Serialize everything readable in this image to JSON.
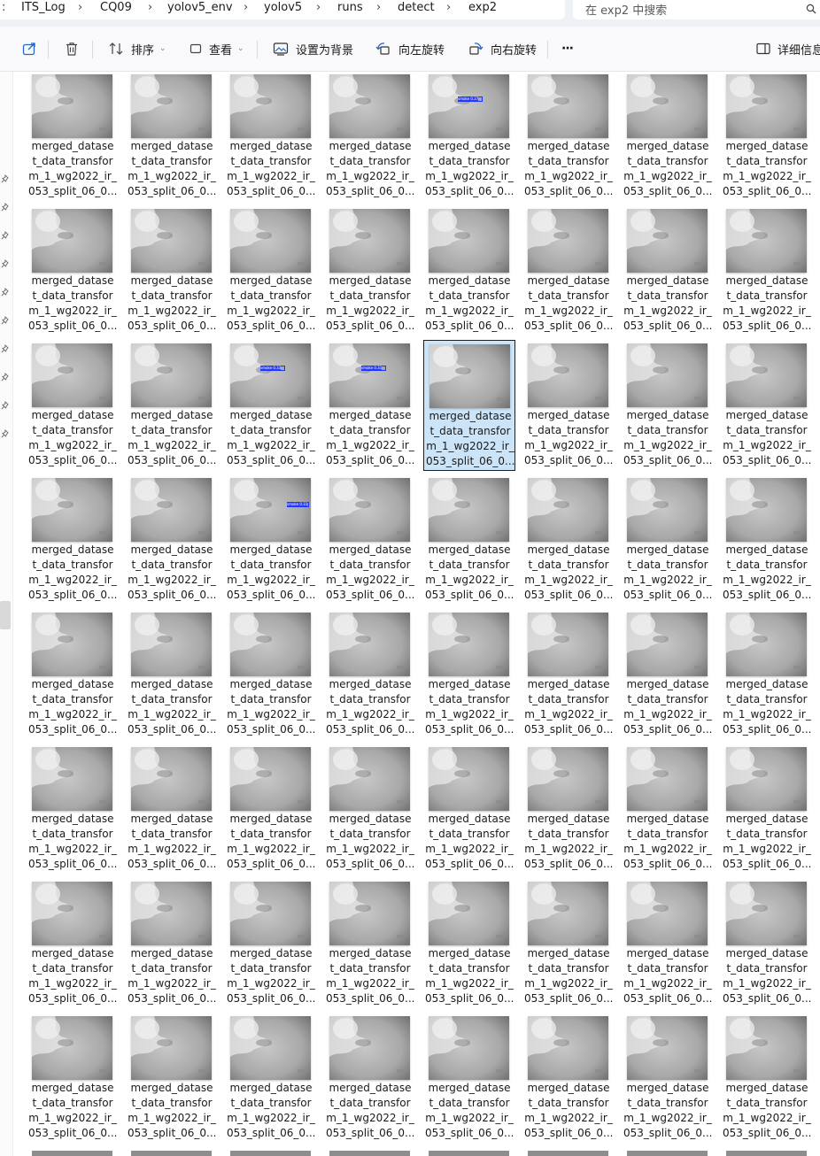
{
  "breadcrumb": [
    "ITS_Log",
    "CQ09",
    "yolov5_env",
    "yolov5",
    "runs",
    "detect",
    "exp2"
  ],
  "search": {
    "placeholder": "在 exp2 中搜索"
  },
  "toolbar": {
    "share_label": "",
    "delete_label": "",
    "sort_label": "排序",
    "view_label": "查看",
    "set_bg_label": "设置为背景",
    "rotate_left_label": "向左旋转",
    "rotate_right_label": "向右旋转",
    "more_label": "···",
    "details_label": "详细信息"
  },
  "files": {
    "caption_lines": [
      "merged_datase",
      "t_data_transfor",
      "m_1_wg2022_ir_",
      "053_split_06_0..."
    ],
    "columns": 8,
    "rows": 8,
    "selected_index": 20,
    "detections": [
      {
        "index": 4,
        "label": "smoke 0.37"
      },
      {
        "index": 18,
        "label": "smoke 0.33"
      },
      {
        "index": 19,
        "label": "smoke 0.31"
      },
      {
        "index": 26,
        "label": "smoke 0.31"
      }
    ]
  }
}
